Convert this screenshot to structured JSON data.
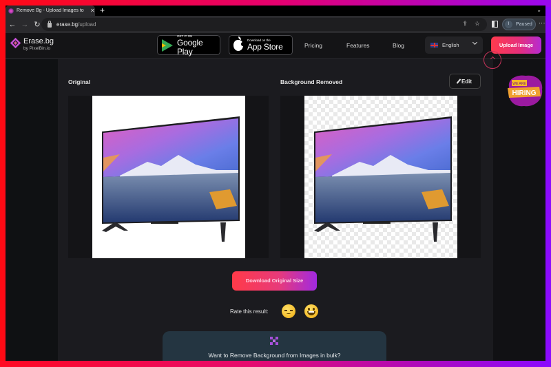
{
  "browser": {
    "tab_title": "Remove Bg - Upload Images to",
    "tab_close": "✕",
    "new_tab": "+",
    "tab_list": "⌄",
    "nav": {
      "back": "←",
      "forward": "→",
      "reload": "↻"
    },
    "url_host": "erase.bg",
    "url_path": "/upload",
    "omni_icons": {
      "share": "⇪",
      "bookmark": "☆"
    },
    "profile_initial": "I",
    "profile_status": "Paused",
    "menu": "⋮"
  },
  "header": {
    "logo_title": "Erase.bg",
    "logo_subtitle": "by PixelBin.io",
    "google_play": {
      "small": "GET IT ON",
      "big": "Google Play"
    },
    "app_store": {
      "small": "Download on the",
      "big": "App Store"
    },
    "nav_links": [
      "Pricing",
      "Features",
      "Blog"
    ],
    "language": "English",
    "upload_button": "Upload Image"
  },
  "main": {
    "original_label": "Original",
    "removed_label": "Background Removed",
    "edit_button": "Edit",
    "download_button": "Download Original Size",
    "rate_label": "Rate this result:",
    "bulk_text": "Want to Remove Background from Images in bulk?",
    "hiring_top": "WE ARE",
    "hiring_main": "HIRING"
  },
  "colors": {
    "accent_start": "#ff3b4d",
    "accent_end": "#b52bd3",
    "page_bg": "#1b1b1f",
    "card_bg": "#243541"
  }
}
